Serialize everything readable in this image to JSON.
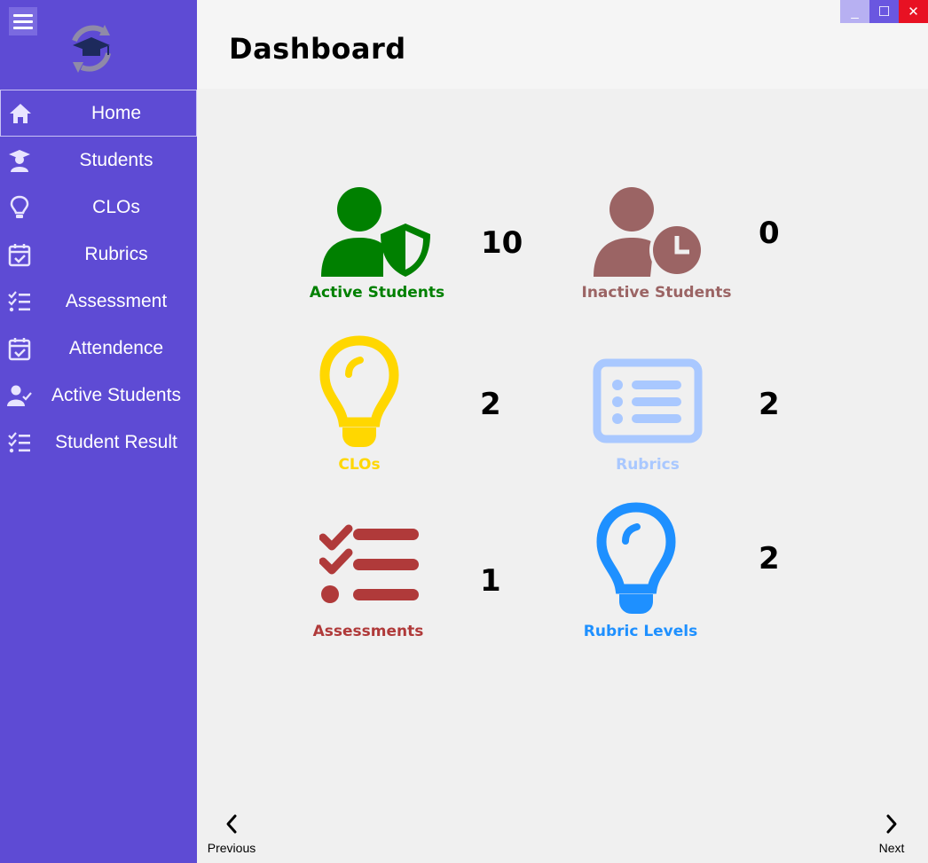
{
  "window": {
    "minimize_glyph": "_",
    "maximize_glyph": "☐",
    "close_glyph": "✕"
  },
  "header": {
    "title": "Dashboard"
  },
  "sidebar": {
    "items": [
      {
        "label": "Home",
        "icon": "home-icon"
      },
      {
        "label": "Students",
        "icon": "student-icon"
      },
      {
        "label": "CLOs",
        "icon": "lightbulb-icon"
      },
      {
        "label": "Rubrics",
        "icon": "calendar-check-icon"
      },
      {
        "label": "Assessment",
        "icon": "checklist-icon"
      },
      {
        "label": "Attendence",
        "icon": "calendar-check-icon"
      },
      {
        "label": "Active Students",
        "icon": "user-check-icon"
      },
      {
        "label": "Student Result",
        "icon": "checklist-icon"
      }
    ]
  },
  "cards": {
    "active_students": {
      "label": "Active Students",
      "count": "10",
      "color": "#008000"
    },
    "inactive_students": {
      "label": "Inactive Students",
      "count": "0",
      "color": "#9b6464"
    },
    "clos": {
      "label": "CLOs",
      "count": "2",
      "color": "#ffd700"
    },
    "rubrics": {
      "label": "Rubrics",
      "count": "2",
      "color": "#a9c8ff"
    },
    "assessments": {
      "label": "Assessments",
      "count": "1",
      "color": "#b03a3a"
    },
    "rubric_levels": {
      "label": "Rubric Levels",
      "count": "2",
      "color": "#1e90ff"
    }
  },
  "pager": {
    "previous_label": "Previous",
    "next_label": "Next"
  }
}
